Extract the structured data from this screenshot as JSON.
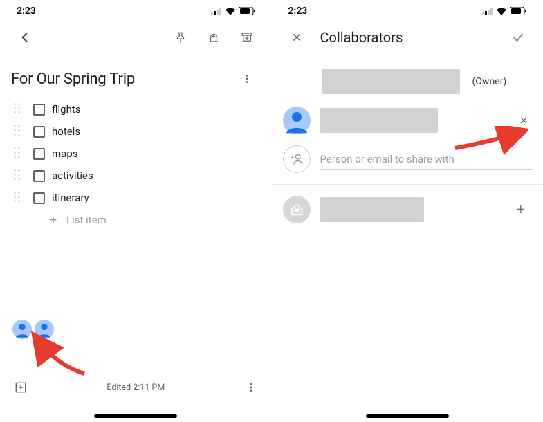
{
  "status": {
    "time": "2:23"
  },
  "note": {
    "title": "For Our Spring Trip",
    "items": [
      "flights",
      "hotels",
      "maps",
      "activities",
      "itinerary"
    ],
    "add_item_placeholder": "List item",
    "edited": "Edited 2:11 PM"
  },
  "collab": {
    "title": "Collaborators",
    "owner_label": "(Owner)",
    "add_placeholder": "Person or email to share with"
  }
}
